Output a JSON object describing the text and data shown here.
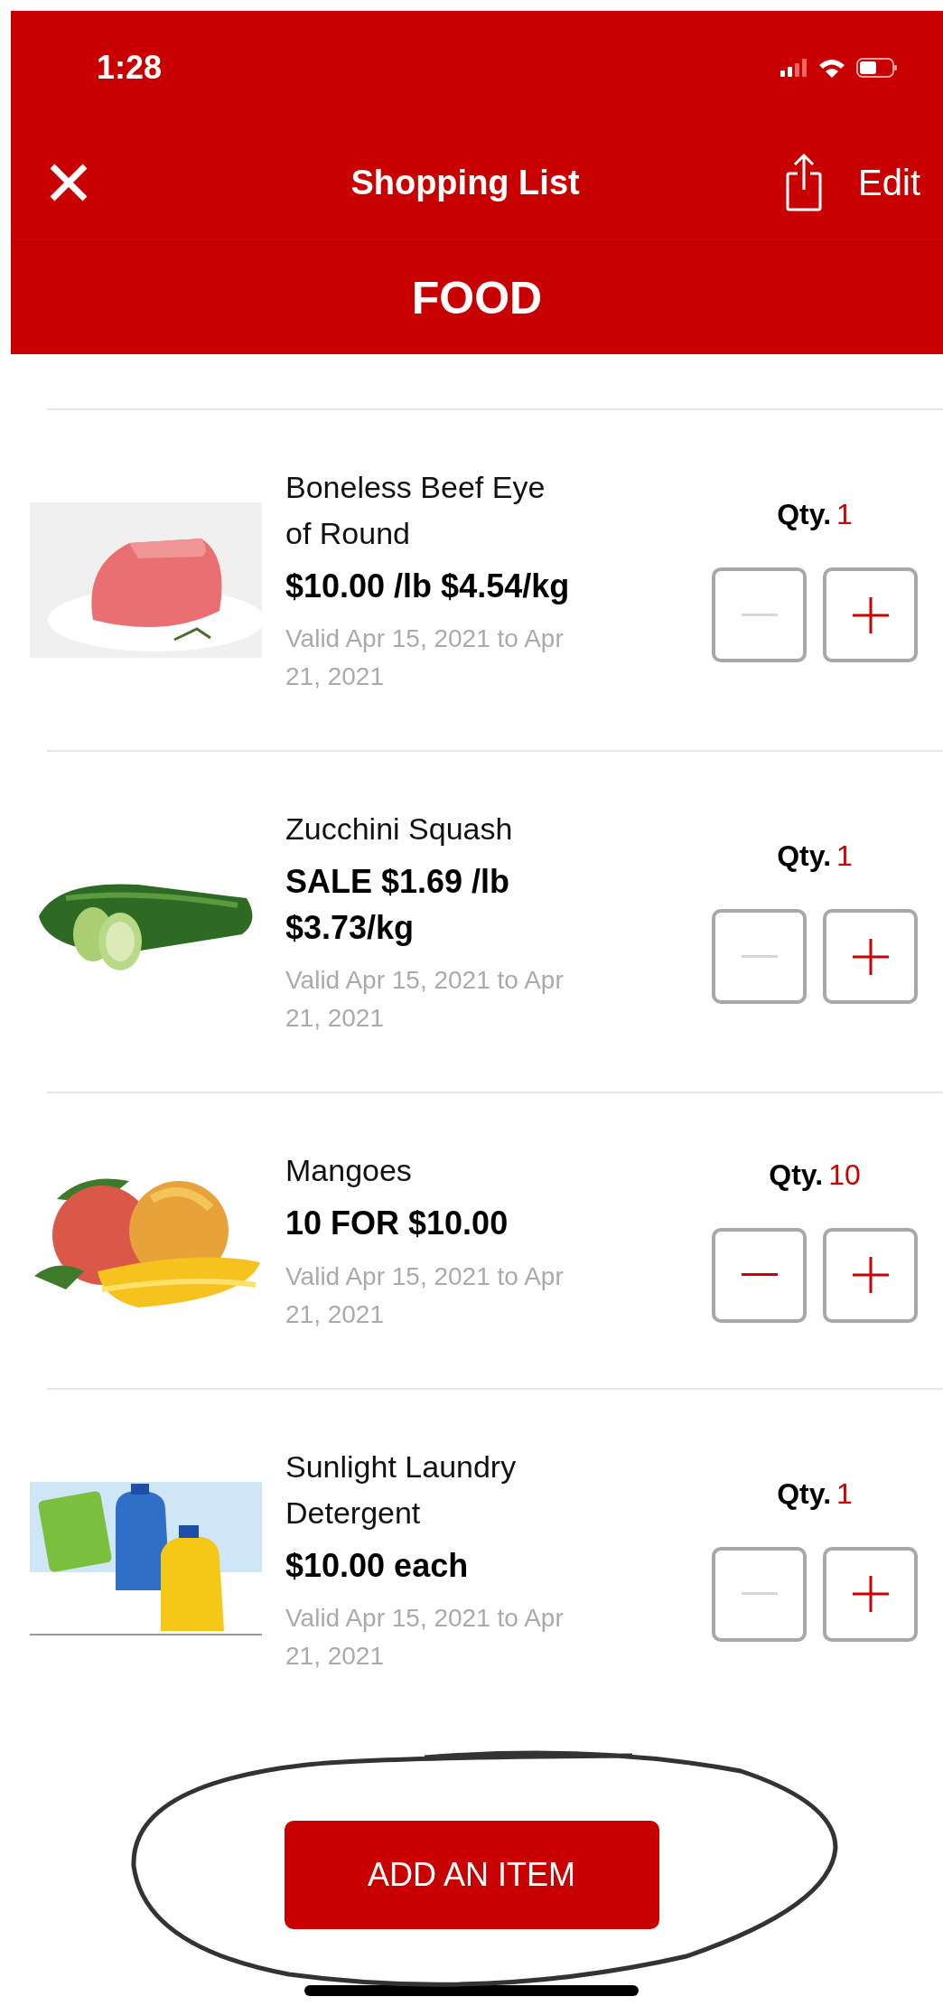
{
  "status_bar": {
    "time": "1:28"
  },
  "nav": {
    "title": "Shopping List",
    "edit": "Edit"
  },
  "category": "FOOD",
  "items": [
    {
      "name": "Boneless Beef Eye of Round",
      "price": "$10.00 /lb $4.54/kg",
      "valid": "Valid Apr 15, 2021 to Apr 21, 2021",
      "qty_label": "Qty.",
      "qty": "1",
      "decrease_disabled": true
    },
    {
      "name": "Zucchini Squash",
      "price": "SALE $1.69 /lb $3.73/kg",
      "valid": "Valid Apr 15, 2021 to Apr 21, 2021",
      "qty_label": "Qty.",
      "qty": "1",
      "decrease_disabled": true
    },
    {
      "name": "Mangoes",
      "price": "10 FOR $10.00",
      "valid": "Valid Apr 15, 2021 to Apr 21, 2021",
      "qty_label": "Qty.",
      "qty": "10",
      "decrease_disabled": false
    },
    {
      "name": "Sunlight Laundry Detergent",
      "price": "$10.00 each",
      "valid": "Valid Apr 15, 2021 to Apr 21, 2021",
      "qty_label": "Qty.",
      "qty": "1",
      "decrease_disabled": true
    }
  ],
  "add_button": "ADD AN ITEM"
}
